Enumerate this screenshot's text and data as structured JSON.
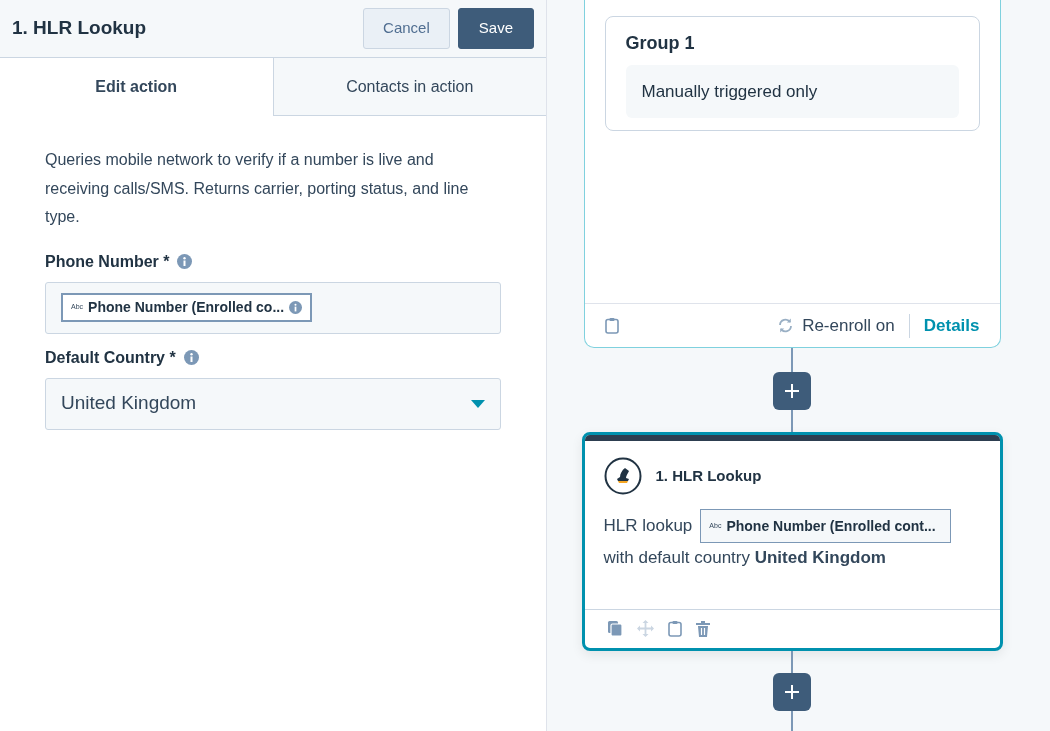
{
  "panel": {
    "title": "1. HLR Lookup",
    "buttons": [
      {
        "label": "Cancel",
        "kind": "secondary"
      },
      {
        "label": "Save",
        "kind": "primary"
      }
    ],
    "tabs": [
      {
        "label": "Edit action",
        "selected": true
      },
      {
        "label": "Contacts in action",
        "selected": false
      }
    ],
    "description": "Queries mobile network to verify if a number is live and receiving calls/SMS. Returns carrier, porting status, and line type.",
    "fields": [
      {
        "kind": "token",
        "label": "Phone Number *",
        "type_label": "Abc",
        "value": "Phone Number (Enrolled co..."
      },
      {
        "kind": "select",
        "label": "Default Country *",
        "value": "United Kingdom"
      }
    ]
  },
  "canvas": {
    "trigger": {
      "group_title": "Group 1",
      "condition": "Manually triggered only",
      "reenroll": "Re-enroll on",
      "details": "Details"
    },
    "action": {
      "selected": true,
      "title": "1. HLR Lookup",
      "lead": "HLR lookup",
      "type_label": "Abc",
      "token": "Phone Number (Enrolled cont...",
      "sentence": "with default country **United Kingdom**"
    }
  }
}
